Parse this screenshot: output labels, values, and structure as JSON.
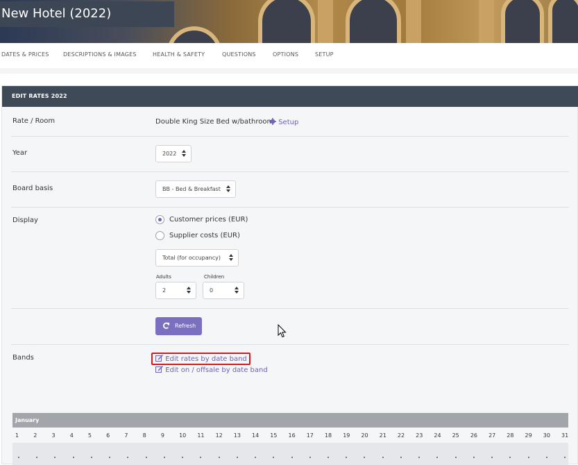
{
  "hotel": {
    "title": "New Hotel (2022)"
  },
  "tabs": [
    {
      "label": "DATES & PRICES"
    },
    {
      "label": "DESCRIPTIONS & IMAGES"
    },
    {
      "label": "HEALTH & SAFETY"
    },
    {
      "label": "QUESTIONS"
    },
    {
      "label": "OPTIONS"
    },
    {
      "label": "SETUP"
    }
  ],
  "panel": {
    "title": "EDIT RATES 2022",
    "rate_room": {
      "label": "Rate / Room",
      "value": "Double King Size Bed w/bathroom",
      "setup_link": "Setup",
      "setup_icon": "gear-icon"
    },
    "year": {
      "label": "Year",
      "value": "2022"
    },
    "board_basis": {
      "label": "Board basis",
      "value": "BB - Bed & Breakfast"
    },
    "display": {
      "label": "Display",
      "options": [
        {
          "label": "Customer prices (EUR)",
          "checked": true
        },
        {
          "label": "Supplier costs (EUR)",
          "checked": false
        }
      ],
      "pricing_mode": "Total (for occupancy)",
      "adults_label": "Adults",
      "adults_value": "2",
      "children_label": "Children",
      "children_value": "0"
    },
    "refresh_button": {
      "label": "Refresh",
      "icon": "refresh-icon"
    },
    "bands": {
      "label": "Bands",
      "links": [
        {
          "label": "Edit rates by date band",
          "icon": "edit-icon",
          "highlighted": true
        },
        {
          "label": "Edit on / offsale by date band",
          "icon": "edit-icon",
          "highlighted": false
        }
      ]
    }
  },
  "calendar": {
    "month": "January",
    "days": [
      "1",
      "2",
      "3",
      "4",
      "5",
      "6",
      "7",
      "8",
      "9",
      "10",
      "11",
      "12",
      "13",
      "14",
      "15",
      "16",
      "17",
      "18",
      "19",
      "20",
      "21",
      "22",
      "23",
      "24",
      "25",
      "26",
      "27",
      "28",
      "29",
      "30",
      "31"
    ]
  },
  "colors": {
    "header_bg": "#3f4a59",
    "accent": "#6b63b5",
    "button": "#7b6fc0",
    "highlight": "#d11a1a"
  }
}
